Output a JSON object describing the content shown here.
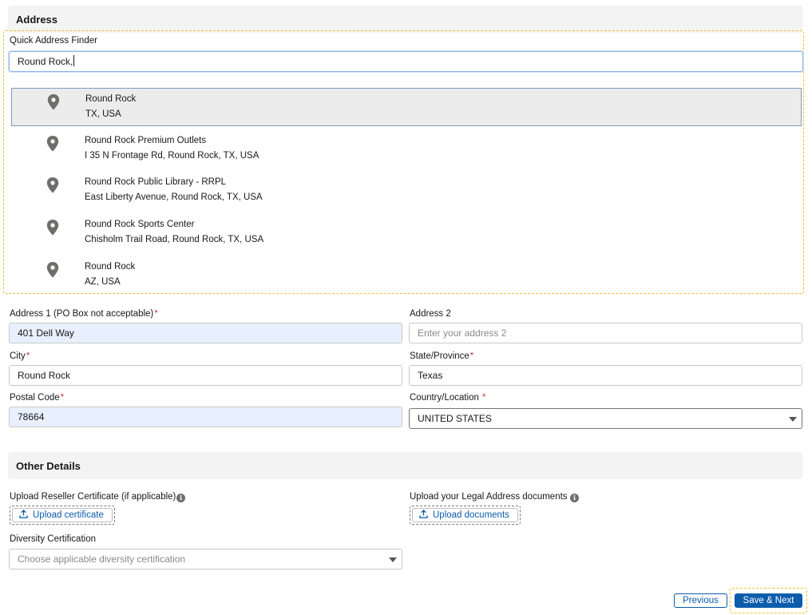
{
  "address_section": {
    "title": "Address",
    "finder": {
      "label": "Quick Address Finder",
      "value": "Round Rock,",
      "suggestions": [
        {
          "name": "Round Rock",
          "detail": "TX, USA",
          "icon": "map-pin-icon"
        },
        {
          "name": "Round Rock Premium Outlets",
          "detail": "I 35 N Frontage Rd, Round Rock, TX, USA",
          "icon": "map-pin-icon"
        },
        {
          "name": "Round Rock Public Library - RRPL",
          "detail": "East Liberty Avenue, Round Rock, TX, USA",
          "icon": "map-pin-icon"
        },
        {
          "name": "Round Rock Sports Center",
          "detail": "Chisholm Trail Road, Round Rock, TX, USA",
          "icon": "map-pin-icon"
        },
        {
          "name": "Round Rock",
          "detail": "AZ, USA",
          "icon": "map-pin-icon"
        }
      ]
    },
    "address1": {
      "label": "Address 1 (PO Box not acceptable)",
      "value": "401 Dell Way"
    },
    "address2": {
      "label": "Address 2",
      "placeholder": "Enter your address 2"
    },
    "city": {
      "label": "City",
      "value": "Round Rock"
    },
    "state": {
      "label": "State/Province",
      "value": "Texas"
    },
    "postal": {
      "label": "Postal Code",
      "value": "78664"
    },
    "country": {
      "label": "Country/Location",
      "value": "UNITED STATES"
    },
    "required_mark": "*"
  },
  "other_section": {
    "title": "Other Details",
    "reseller": {
      "label": "Upload Reseller Certificate (if applicable)",
      "button": "Upload certificate",
      "icon": "upload-icon"
    },
    "legal": {
      "label": "Upload your Legal Address documents",
      "button": "Upload documents",
      "icon": "upload-icon"
    },
    "diversity": {
      "label": "Diversity Certification",
      "placeholder": "Choose applicable diversity certification"
    },
    "info_icon": "i"
  },
  "footer": {
    "previous": "Previous",
    "save_next": "Save & Next"
  },
  "colors": {
    "brand": "#0b5cab",
    "highlight_dashed": "#f2c230",
    "required": "#c23934",
    "autofill": "#e8f0fe"
  }
}
